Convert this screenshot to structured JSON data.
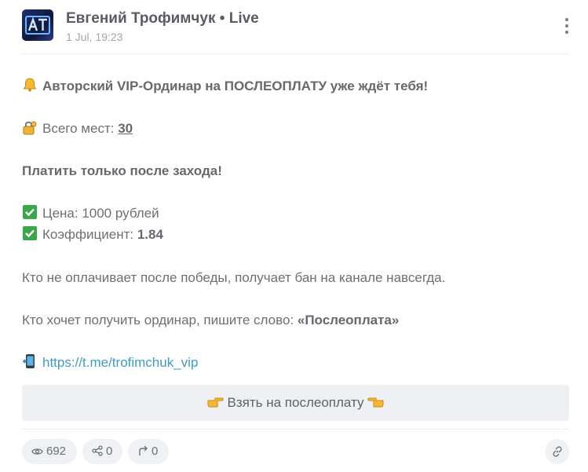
{
  "header": {
    "channel_name": "Евгений Трофимчук • Live",
    "date": "1 Jul, 19:23",
    "avatar_icon": "channel-logo-icon",
    "menu_icon": "more-vertical-icon"
  },
  "post": {
    "headline": "Авторский VIP-Ординар на ПОСЛЕОПЛАТУ уже ждёт тебя!",
    "headline_icon": "bell-icon",
    "seats_label": "Всего мест:",
    "seats_value": "30",
    "seats_icon": "lock-key-icon",
    "pay_after": "Платить только после захода!",
    "price_label": "Цена: 1000 рублей",
    "coef_label": "Коэффициент:",
    "coef_value": "1.84",
    "check_icon": "check-mark-icon",
    "ban_notice": "Кто не оплачивает после победы, получает бан на канале навсегда.",
    "order_prompt": "Кто хочет получить ординар, пишите слово:",
    "order_word": "«Послеоплата»",
    "link_icon": "mobile-phone-icon",
    "link_url": "https://t.me/trofimchuk_vip"
  },
  "action_button": {
    "label": "Взять на послеоплату",
    "left_icon": "pointing-right-hand-icon",
    "right_icon": "pointing-left-hand-icon"
  },
  "footer": {
    "views": "692",
    "shares": "0",
    "forwards": "0",
    "views_icon": "eye-icon",
    "shares_icon": "share-icon",
    "forwards_icon": "forward-arrow-icon",
    "copy_link_icon": "link-icon"
  },
  "colors": {
    "text": "#6d6f74",
    "link": "#3d9cc4",
    "button_bg": "#eef0f3",
    "check_green": "#3aa84a"
  }
}
